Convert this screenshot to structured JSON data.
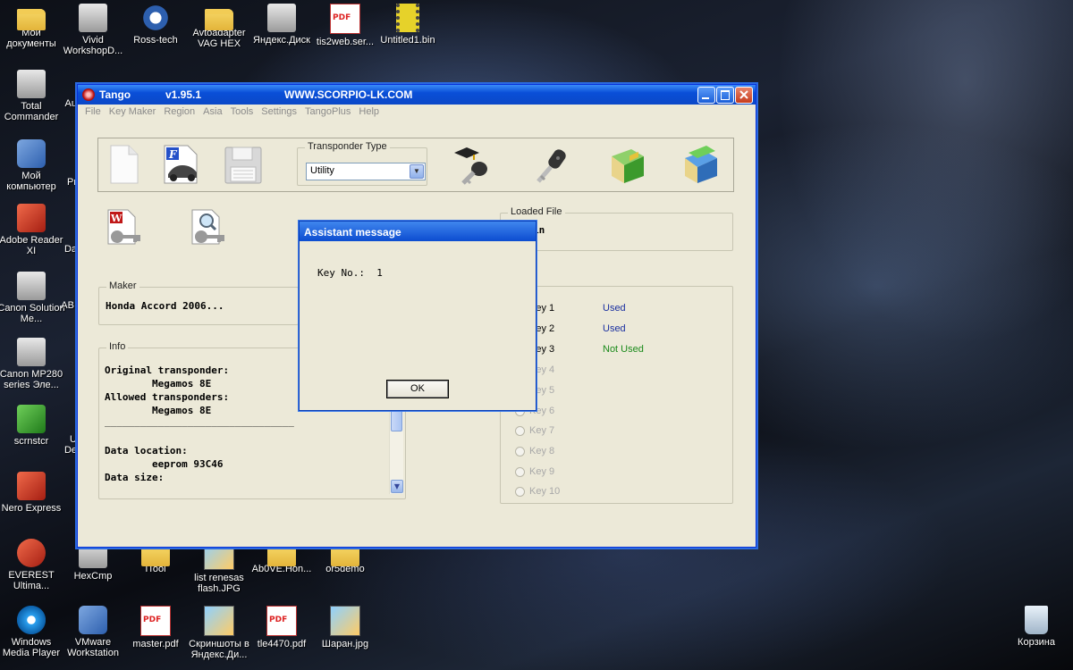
{
  "desktop": {
    "icons_left": [
      {
        "label": "Мои документы",
        "icon": "folder-icon"
      },
      {
        "label": "Total Commander",
        "icon": "total-commander-icon"
      },
      {
        "label": "Мой компьютер",
        "icon": "computer-icon"
      },
      {
        "label": "Adobe Reader XI",
        "icon": "pdf-icon"
      },
      {
        "label": "Canon Solution Me...",
        "icon": "canon-icon"
      },
      {
        "label": "Canon MP280 series Эле...",
        "icon": "printer-icon"
      },
      {
        "label": "scrnstcr",
        "icon": "scrnstcr-icon"
      },
      {
        "label": "Nero Express",
        "icon": "nero-icon"
      },
      {
        "label": "EVEREST Ultima...",
        "icon": "everest-icon"
      },
      {
        "label": "Windows Media Player",
        "icon": "media-player-icon"
      }
    ],
    "icons_top": [
      {
        "label": "Vivid WorkshopD...",
        "icon": "vivid-icon"
      },
      {
        "label": "Ross-tech",
        "icon": "gear-icon"
      },
      {
        "label": "Avtoadapter VAG HEX",
        "icon": "folder-icon"
      },
      {
        "label": "Яндекс.Диск",
        "icon": "window-icon"
      },
      {
        "label": "tis2web.ser...",
        "icon": "pdf-icon"
      },
      {
        "label": "Untitled1.bin",
        "icon": "chip-icon"
      }
    ],
    "icons_bottom": [
      {
        "label": "HexCmp",
        "icon": "hexcmp-icon"
      },
      {
        "label": "ITool",
        "icon": "folder-icon"
      },
      {
        "label": "list renesas flash.JPG",
        "icon": "image-icon"
      },
      {
        "label": "Ab0VE.Hon...",
        "icon": "folder-icon"
      },
      {
        "label": "or5demo",
        "icon": "folder-icon"
      }
    ],
    "icons_bottom2": [
      {
        "label": "VMware Workstation",
        "icon": "vmware-icon"
      },
      {
        "label": "master.pdf",
        "icon": "pdf-icon"
      },
      {
        "label": "Скриншоты в Яндекс.Ди...",
        "icon": "screenshot-icon"
      },
      {
        "label": "tle4470.pdf",
        "icon": "pdf-icon"
      },
      {
        "label": "Шаран.jpg",
        "icon": "image-icon"
      }
    ],
    "partial_labels": [
      "Au",
      "Pr",
      "Da",
      "ABI",
      "U",
      "De"
    ],
    "recycle_bin": "Корзина"
  },
  "window": {
    "app_name": "Tango",
    "version": "v1.95.1",
    "site": "WWW.SCORPIO-LK.COM",
    "menu": [
      "File",
      "Key Maker",
      "Region",
      "Asia",
      "Tools",
      "Settings",
      "TangoPlus",
      "Help"
    ],
    "transponder_type_label": "Transponder Type",
    "transponder_type_value": "Utility",
    "loaded_file_label": "Loaded File",
    "loaded_file_value": "in",
    "maker_label": "Maker",
    "maker_value": "Honda Accord 2006...",
    "info_label": "Info",
    "info_lines": [
      "Original transponder:",
      "        Megamos 8E",
      "Allowed transponders:",
      "        Megamos 8E",
      "________________________________",
      "",
      "Data location:",
      "        eeprom 93C46",
      "Data size:"
    ],
    "keys": [
      {
        "label": "Key 1",
        "status": "Used",
        "status_color": "#1a2fa0",
        "enabled": true
      },
      {
        "label": "Key 2",
        "status": "Used",
        "status_color": "#1a2fa0",
        "enabled": true
      },
      {
        "label": "Key 3",
        "status": "Not Used",
        "status_color": "#1a8a1a",
        "enabled": true
      },
      {
        "label": "Key 4",
        "status": "",
        "enabled": false
      },
      {
        "label": "Key 5",
        "status": "",
        "enabled": false
      },
      {
        "label": "Key 6",
        "status": "",
        "enabled": false
      },
      {
        "label": "Key 7",
        "status": "",
        "enabled": false
      },
      {
        "label": "Key 8",
        "status": "",
        "enabled": false
      },
      {
        "label": "Key 9",
        "status": "",
        "enabled": false
      },
      {
        "label": "Key 10",
        "status": "",
        "enabled": false
      }
    ]
  },
  "dialog": {
    "title": "Assistant message",
    "message": "Key No.:  1",
    "ok": "OK"
  },
  "colors": {
    "xp_title_blue": "#0a4fd8",
    "window_bg": "#ece9d8",
    "used": "#1a2fa0",
    "not_used": "#1a8a1a",
    "disabled": "#a8a8a8"
  }
}
